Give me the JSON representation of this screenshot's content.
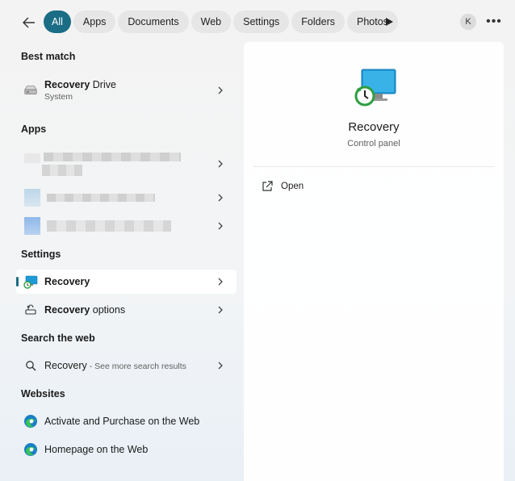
{
  "filters": [
    "All",
    "Apps",
    "Documents",
    "Web",
    "Settings",
    "Folders",
    "Photos"
  ],
  "account_initial": "K",
  "best_match": {
    "heading": "Best match",
    "title_bold": "Recovery",
    "title_rest": " Drive",
    "subtitle": "System"
  },
  "apps": {
    "heading": "Apps"
  },
  "settings": {
    "heading": "Settings",
    "items": [
      {
        "bold": "Recovery",
        "rest": ""
      },
      {
        "bold": "Recovery",
        "rest": " options"
      }
    ]
  },
  "web": {
    "heading": "Search the web",
    "query": "Recovery",
    "hint": " - See more search results"
  },
  "websites": {
    "heading": "Websites",
    "items": [
      "Activate and Purchase on the Web",
      "Homepage on the Web"
    ]
  },
  "detail": {
    "title": "Recovery",
    "subtitle": "Control panel",
    "action": "Open"
  },
  "colors": {
    "accent": "#1b6d85",
    "edge_blue": "#1a7fc4"
  }
}
